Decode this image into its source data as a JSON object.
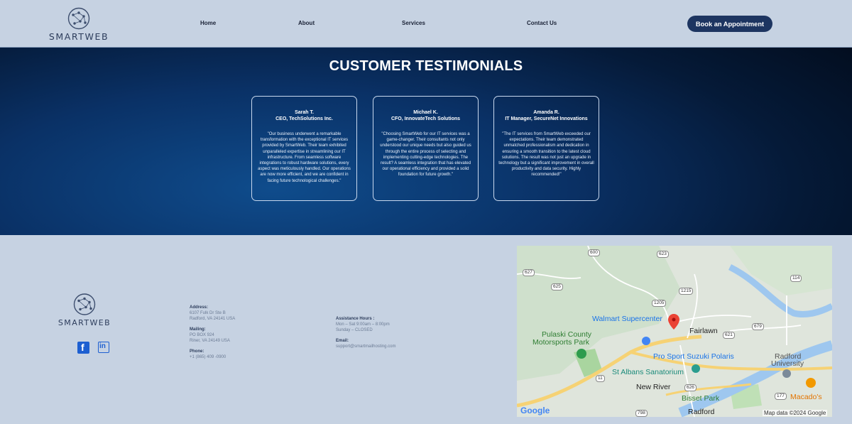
{
  "header": {
    "logo_text": "SMARTWEB",
    "nav": [
      {
        "label": "Home"
      },
      {
        "label": "About"
      },
      {
        "label": "Services"
      },
      {
        "label": "Contact Us"
      }
    ],
    "cta_label": "Book an Appointment"
  },
  "testimonials": {
    "title": "CUSTOMER TESTIMONIALS",
    "cards": [
      {
        "name": "Sarah T.",
        "role": "CEO, TechSolutions Inc.",
        "quote": "\"Our business underwent a remarkable transformation with the exceptional IT services provided by SmartWeb. Their team exhibited unparalleled expertise in streamlining our IT infrastructure. From seamless software integrations to robust hardware solutions, every aspect was meticulously handled. Our operations are now more efficient, and we are confident in facing future technological challenges.\""
      },
      {
        "name": "Michael K.",
        "role": "CFO, InnovateTech Solutions",
        "quote": "\"Choosing SmartWeb for our IT services was a game-changer. Their consultants not only understood our unique needs but also guided us through the entire process of selecting and implementing cutting-edge technologies. The result? A seamless integration that has elevated our operational efficiency and provided a solid foundation for future growth.\""
      },
      {
        "name": "Amanda R.",
        "role": "IT Manager, SecureNet Innovations",
        "quote": "\"The IT services from SmartWeb exceeded our expectations. Their team demonstrated unmatched professionalism and dedication in ensuring a smooth transition to the latest cloud solutions. The result was not just an upgrade in technology but a significant improvement in overall productivity and data security. Highly recommended!\""
      }
    ]
  },
  "footer": {
    "logo_text": "SMARTWEB",
    "social": [
      {
        "icon": "facebook-icon",
        "glyph": "f"
      },
      {
        "icon": "linkedin-icon",
        "glyph": "in"
      }
    ],
    "address_label": "Address:",
    "address_line1": "6107 Fulk Dr Ste B",
    "address_line2": "Radford, VA 24141 USA",
    "mailing_label": "Mailing:",
    "mailing_line1": "PO BOX 924",
    "mailing_line2": "Riner, VA 24149 USA",
    "phone_label": "Phone:",
    "phone_value": "+1 (865) 409 -0900",
    "hours_label": "Assistance Hours :",
    "hours_line1": "Mon – Sat 9:00am – 8:00pm",
    "hours_line2": "Sunday – CLOSED",
    "email_label": "Email:",
    "email_value": "support@smartmailhosting.com"
  },
  "map": {
    "labels": {
      "walmart": "Walmart Supercenter",
      "pulaski_1": "Pulaski County",
      "pulaski_2": "Motorsports Park",
      "fairlawn": "Fairlawn",
      "pro_sport": "Pro Sport Suzuki Polaris",
      "st_albans": "St Albans Sanatorium",
      "radford_univ_1": "Radford",
      "radford_univ_2": "University",
      "new_river": "New River",
      "bisset": "Bisset Park",
      "macados": "Macado's",
      "radford": "Radford",
      "google": "Google",
      "attribution": "Map data ©2024 Google"
    },
    "shields": [
      "600",
      "623",
      "627",
      "625",
      "1215",
      "1205",
      "114",
      "679",
      "621",
      "11",
      "626",
      "177",
      "798"
    ]
  }
}
